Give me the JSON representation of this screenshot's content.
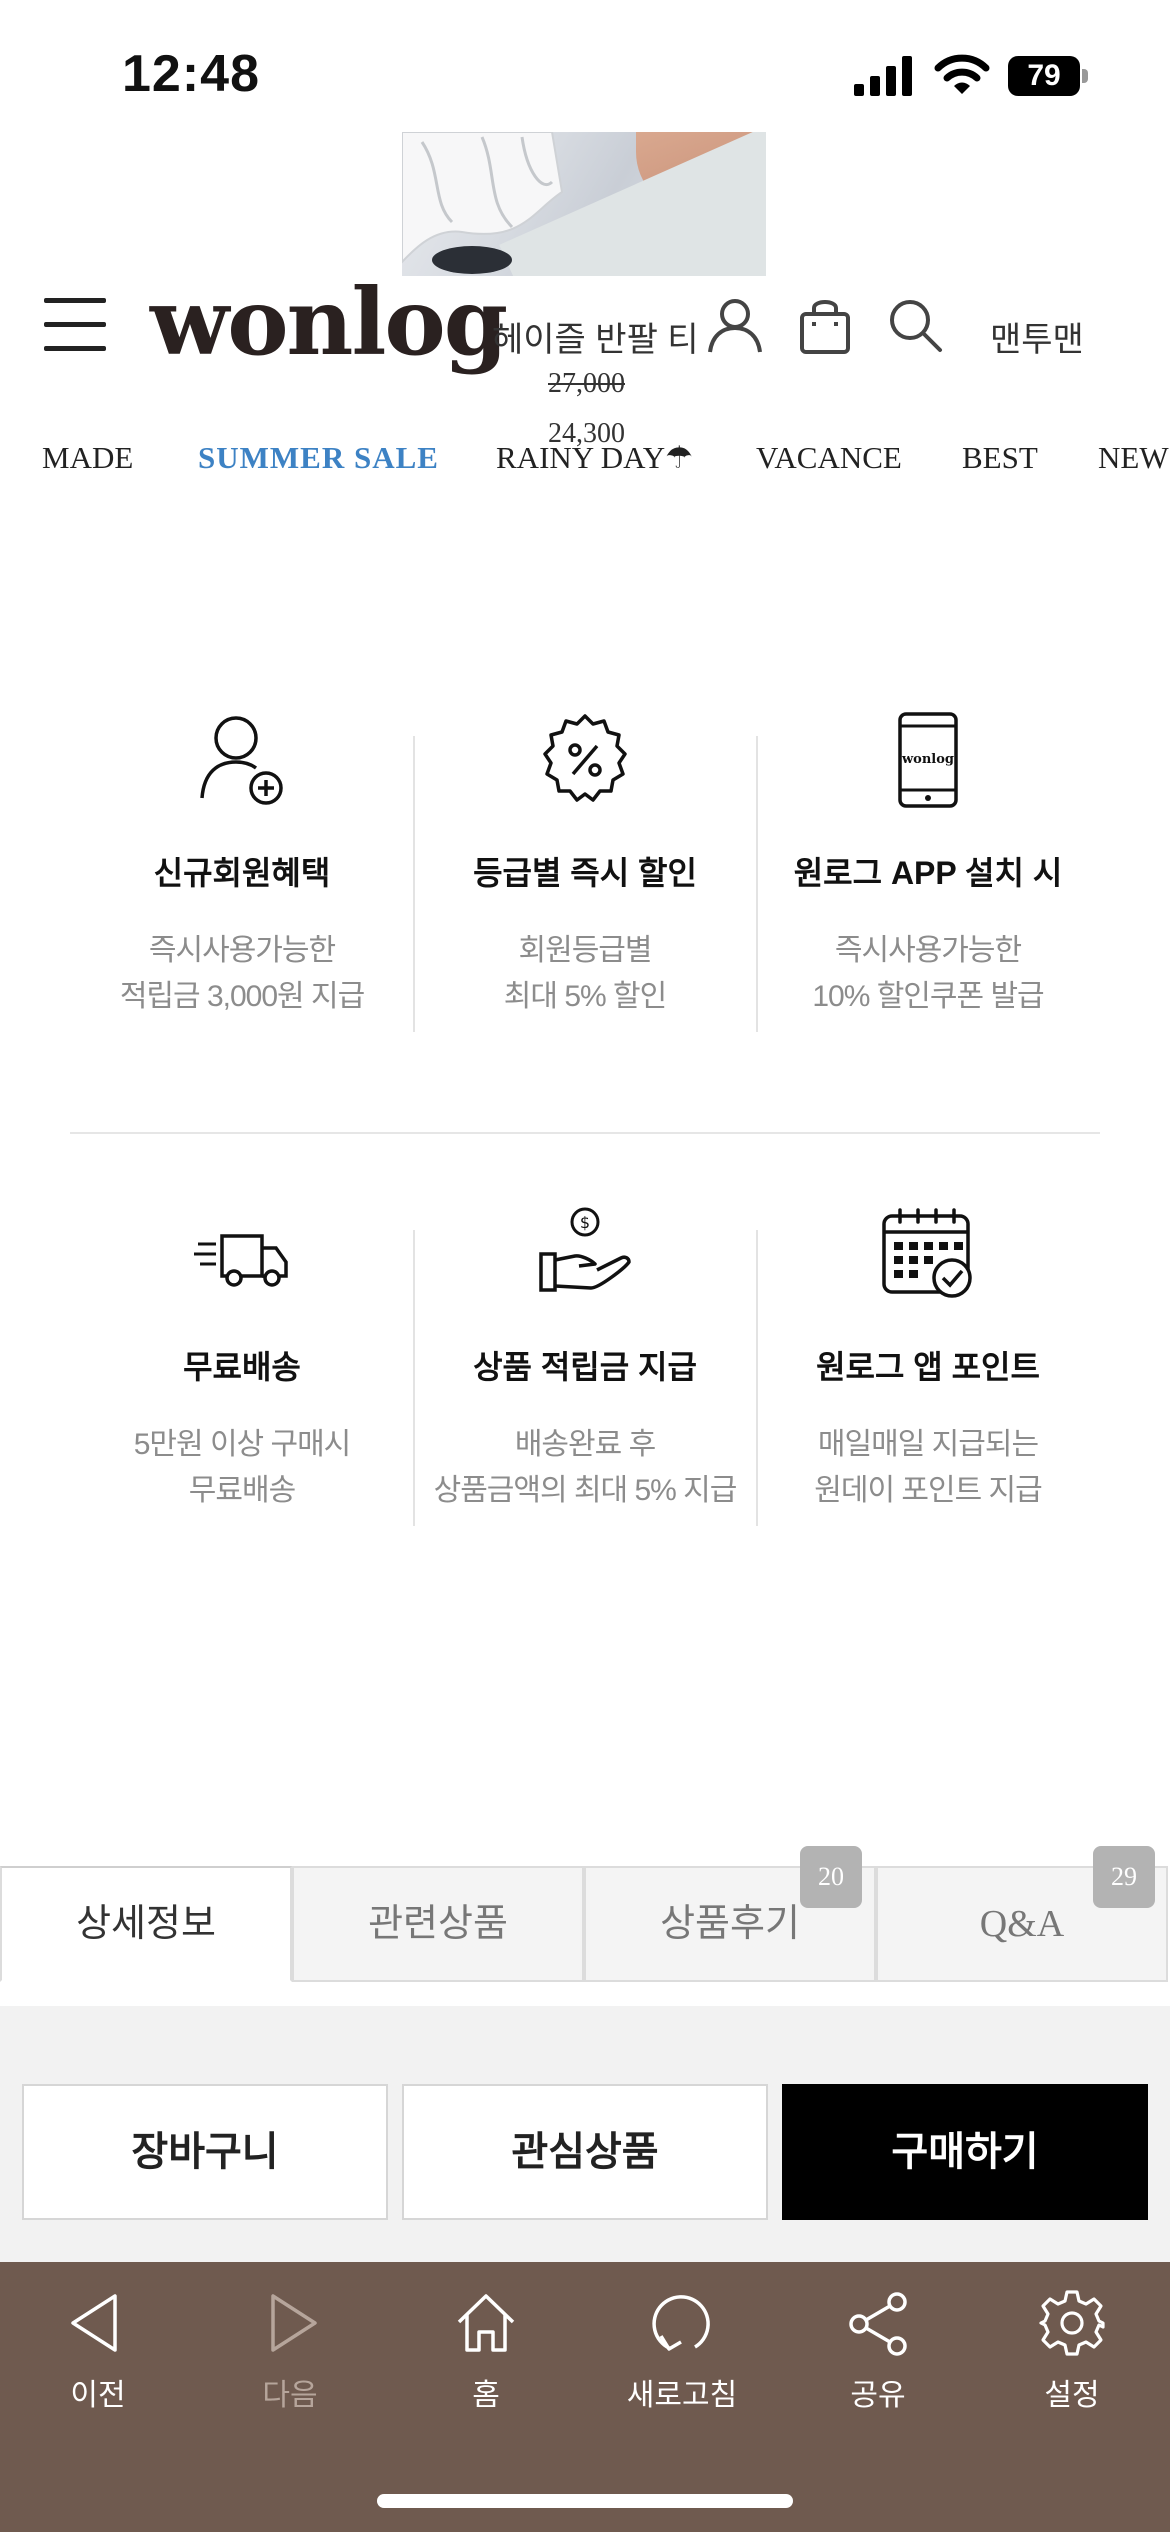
{
  "status_bar": {
    "time": "12:48",
    "battery": "79"
  },
  "header": {
    "logo": "wonlog",
    "product_name": "헤이즐 반팔 티",
    "original_price": "27,000",
    "sale_price": "24,300",
    "right_label": "맨투맨"
  },
  "categories": [
    {
      "label": "MADE"
    },
    {
      "label": "SUMMER SALE",
      "active": true
    },
    {
      "label": "RAINY DAY☂"
    },
    {
      "label": "VACANCE"
    },
    {
      "label": "BEST"
    },
    {
      "label": "NEW"
    }
  ],
  "benefits": [
    {
      "icon": "user-add-icon",
      "title": "신규회원혜택",
      "desc": "즉시사용가능한\n적립금 3,000원 지급"
    },
    {
      "icon": "discount-badge-icon",
      "title": "등급별 즉시 할인",
      "desc": "회원등급별\n최대 5% 할인"
    },
    {
      "icon": "mobile-app-icon",
      "title": "원로그 APP 설치 시",
      "desc": "즉시사용가능한\n10% 할인쿠폰 발급",
      "icon_text": "wonlog"
    },
    {
      "icon": "delivery-truck-icon",
      "title": "무료배송",
      "desc": "5만원 이상 구매시\n무료배송"
    },
    {
      "icon": "hand-coin-icon",
      "title": "상품 적립금 지급",
      "desc": "배송완료 후\n상품금액의 최대 5% 지급"
    },
    {
      "icon": "calendar-check-icon",
      "title": "원로그 앱 포인트",
      "desc": "매일매일 지급되는\n원데이 포인트 지급"
    }
  ],
  "tabs": [
    {
      "label": "상세정보",
      "active": true
    },
    {
      "label": "관련상품"
    },
    {
      "label": "상품후기",
      "badge": "20"
    },
    {
      "label": "Q&A",
      "badge": "29"
    }
  ],
  "actions": {
    "cart": "장바구니",
    "wishlist": "관심상품",
    "buy": "구매하기"
  },
  "toolbar": [
    {
      "icon": "back-arrow-icon",
      "label": "이전"
    },
    {
      "icon": "forward-arrow-icon",
      "label": "다음",
      "disabled": true
    },
    {
      "icon": "home-icon",
      "label": "홈"
    },
    {
      "icon": "refresh-icon",
      "label": "새로고침"
    },
    {
      "icon": "share-icon",
      "label": "공유"
    },
    {
      "icon": "settings-gear-icon",
      "label": "설정"
    }
  ],
  "colors": {
    "accent": "#3d82c4",
    "toolbar_bg": "#6f5a4f",
    "buy_bg": "#000000"
  }
}
